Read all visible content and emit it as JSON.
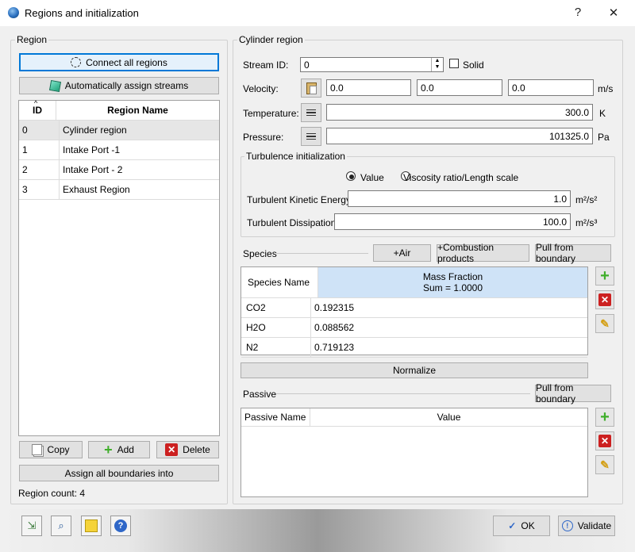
{
  "window": {
    "title": "Regions and initialization",
    "help_glyph": "?",
    "close_glyph": "✕"
  },
  "region_panel": {
    "title": "Region",
    "connect_label": "Connect all regions",
    "auto_assign_label": "Automatically assign streams",
    "table_headers": {
      "id": "ID",
      "name": "Region Name"
    },
    "rows": [
      {
        "id": "0",
        "name": "Cylinder region"
      },
      {
        "id": "1",
        "name": "Intake Port -1"
      },
      {
        "id": "2",
        "name": "Intake Port - 2"
      },
      {
        "id": "3",
        "name": "Exhaust Region"
      }
    ],
    "copy_label": "Copy",
    "add_label": "Add",
    "delete_label": "Delete",
    "assign_boundaries_label": "Assign all boundaries into",
    "region_count": "Region count: 4"
  },
  "cylinder_panel": {
    "title": "Cylinder region",
    "stream_label": "Stream ID:",
    "stream_value": "0",
    "solid_label": "Solid",
    "velocity_label": "Velocity:",
    "velocity_values": [
      "0.0",
      "0.0",
      "0.0"
    ],
    "velocity_unit": "m/s",
    "temperature_label": "Temperature:",
    "temperature_value": "300.0",
    "temperature_unit": "K",
    "pressure_label": "Pressure:",
    "pressure_value": "101325.0",
    "pressure_unit": "Pa",
    "turbulence": {
      "title": "Turbulence initialization",
      "option_value": "Value",
      "option_viscosity": "Viscosity ratio/Length scale",
      "selected": "Value",
      "tke_label": "Turbulent Kinetic Energy:",
      "tke_value": "1.0",
      "tke_unit": "m²/s²",
      "diss_label": "Turbulent Dissipation:",
      "diss_value": "100.0",
      "diss_unit": "m²/s³"
    },
    "species": {
      "label": "Species",
      "air_button": "+Air",
      "combustion_button": "+Combustion products",
      "pull_button": "Pull from boundary",
      "col_name": "Species Name",
      "col_fraction": "Mass Fraction",
      "col_sum": "Sum = 1.0000",
      "rows": [
        {
          "name": "CO2",
          "value": "0.192315"
        },
        {
          "name": "H2O",
          "value": "0.088562"
        },
        {
          "name": "N2",
          "value": "0.719123"
        }
      ],
      "normalize_label": "Normalize"
    },
    "passive": {
      "label": "Passive",
      "pull_button": "Pull from boundary",
      "col_name": "Passive Name",
      "col_value": "Value"
    }
  },
  "footer": {
    "ok_label": "OK",
    "validate_label": "Validate"
  },
  "colors": {
    "accent": "#0078d7",
    "header_blue": "#cfe3f7",
    "selected_row": "#e6e6e6"
  }
}
